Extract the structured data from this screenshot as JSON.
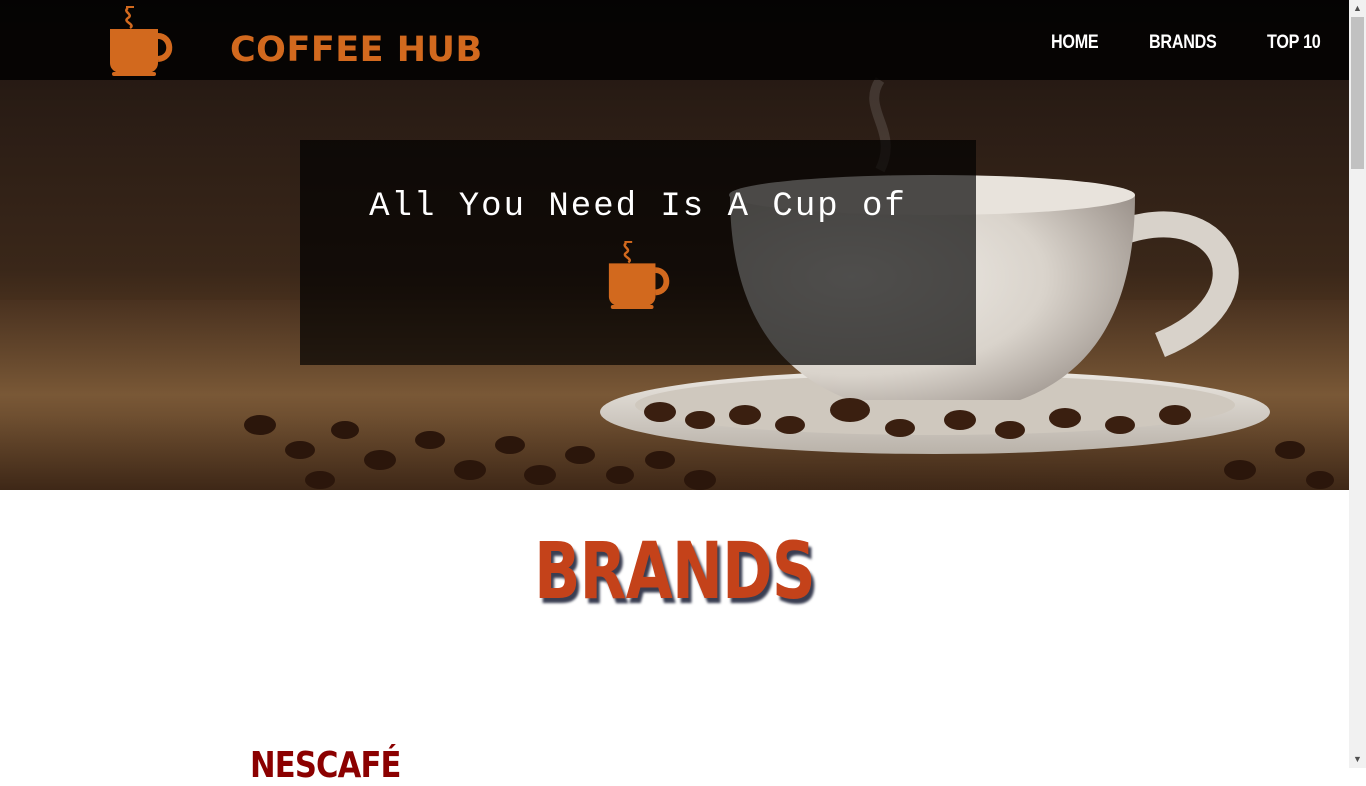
{
  "header": {
    "brand_name": "COFFEE HUB",
    "logo_icon": "coffee-cup-icon",
    "nav": [
      {
        "label": "HOME"
      },
      {
        "label": "BRANDS"
      },
      {
        "label": "TOP 10"
      }
    ]
  },
  "hero": {
    "tagline": "All You Need Is A Cup of",
    "tagline_icon": "coffee-cup-icon",
    "background": "coffee-cup-with-beans-photo"
  },
  "brands_section": {
    "heading": "BRANDS",
    "first_brand": "NESCAFÉ"
  },
  "colors": {
    "accent": "#d2691e",
    "heading": "#c4421a",
    "brand_title": "#8b0000",
    "navbar": "#000000"
  }
}
